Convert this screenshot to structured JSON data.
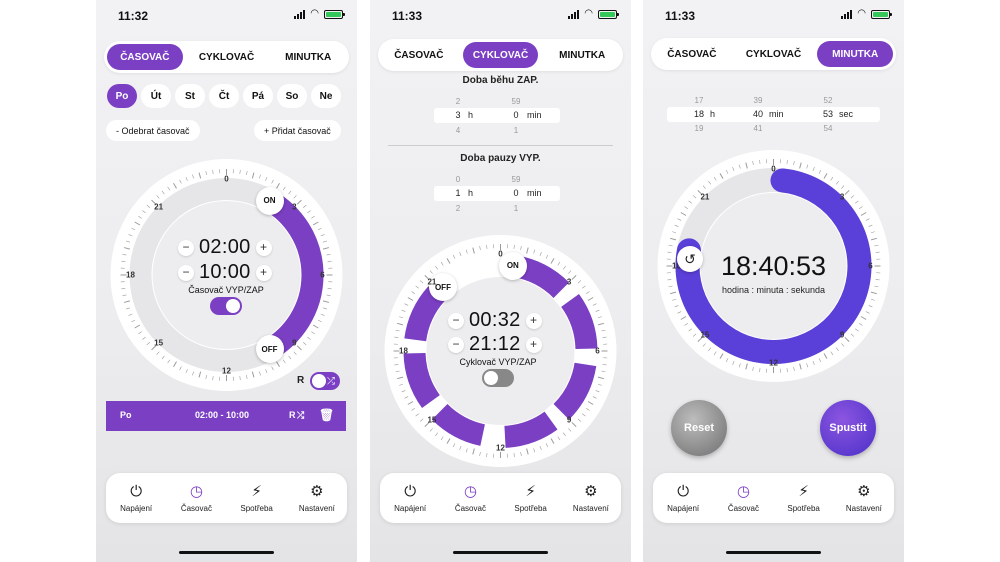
{
  "status_time": [
    "11:32",
    "11:33",
    "11:33"
  ],
  "tabs": [
    "ČASOVAČ",
    "CYKLOVAČ",
    "MINUTKA"
  ],
  "dial_ticks": [
    "0",
    "3",
    "6",
    "9",
    "12",
    "15",
    "18",
    "21"
  ],
  "nav": {
    "items": [
      {
        "label": "Napájení",
        "icon": "power-icon"
      },
      {
        "label": "Časovač",
        "icon": "clock-icon"
      },
      {
        "label": "Spotřeba",
        "icon": "consumption-icon"
      },
      {
        "label": "Nastavení",
        "icon": "gear-icon"
      }
    ]
  },
  "timer": {
    "days": [
      "Po",
      "Út",
      "St",
      "Čt",
      "Pá",
      "So",
      "Ne"
    ],
    "active_day": "Po",
    "remove_label": "- Odebrat časovač",
    "add_label": "+ Přidat časovač",
    "on_badge": "ON",
    "off_badge": "OFF",
    "on_time": "02:00",
    "off_time": "10:00",
    "on_hour": 2,
    "off_hour": 10,
    "toggle_label": "Časovač VYP/ZAP",
    "toggle_on": true,
    "random_label": "R",
    "schedule": {
      "day": "Po",
      "range": "02:00 - 10:00",
      "r": "R"
    }
  },
  "cycler": {
    "on_title": "Doba běhu ZAP.",
    "off_title": "Doba pauzy VYP.",
    "on_picker": {
      "h_prev": "2",
      "h": "3",
      "h_next": "4",
      "m_prev": "59",
      "m": "0",
      "m_next": "1"
    },
    "off_picker": {
      "h_prev": "0",
      "h": "1",
      "h_next": "2",
      "m_prev": "59",
      "m": "0",
      "m_next": "1"
    },
    "unit_h": "h",
    "unit_min": "min",
    "on_badge": "ON",
    "off_badge": "OFF",
    "on_time": "00:32",
    "off_time": "21:12",
    "toggle_label": "Cyklovač VYP/ZAP",
    "toggle_on": false
  },
  "countdown": {
    "picker": {
      "h_prev": "17",
      "h": "18",
      "h_next": "19",
      "m_prev": "39",
      "m": "40",
      "m_next": "41",
      "s_prev": "52",
      "s": "53",
      "s_next": "54"
    },
    "unit_h": "h",
    "unit_min": "min",
    "unit_sec": "sec",
    "display": "18:40:53",
    "sub": "hodina : minuta : sekunda",
    "progress_start_hour": 0.4,
    "progress_end_hour": 18.7,
    "reset_label": "Reset",
    "start_label": "Spustit"
  },
  "colors": {
    "accent": "#7b3fc4",
    "accent2": "#5a3fd8",
    "track": "#e6e6e9"
  }
}
